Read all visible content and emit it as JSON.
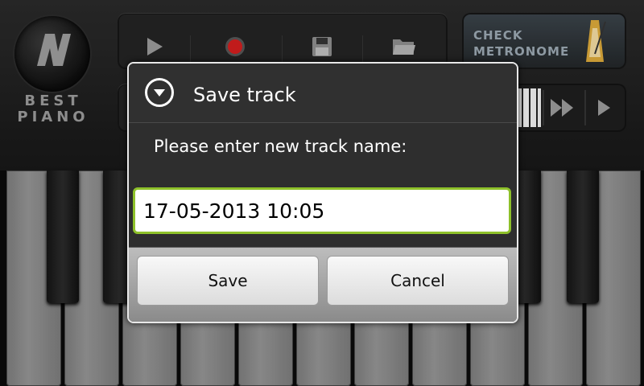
{
  "app": {
    "logo_text": "BEST PIANO",
    "toolbar": {
      "play_icon": "play-icon",
      "record_icon": "record-icon",
      "save_icon": "floppy-disk-icon",
      "open_icon": "folder-open-icon"
    },
    "metronome_label": "CHECK METRONOME",
    "seek": {
      "forward_icon": "fast-forward-icon",
      "next_icon": "play-small-icon"
    },
    "colors": {
      "record_red": "#d21e1e",
      "accent_green": "#8ec12a"
    }
  },
  "dialog": {
    "title": "Save track",
    "message": "Please enter new track name:",
    "input_value": "17-05-2013 10:05",
    "save_label": "Save",
    "cancel_label": "Cancel"
  }
}
